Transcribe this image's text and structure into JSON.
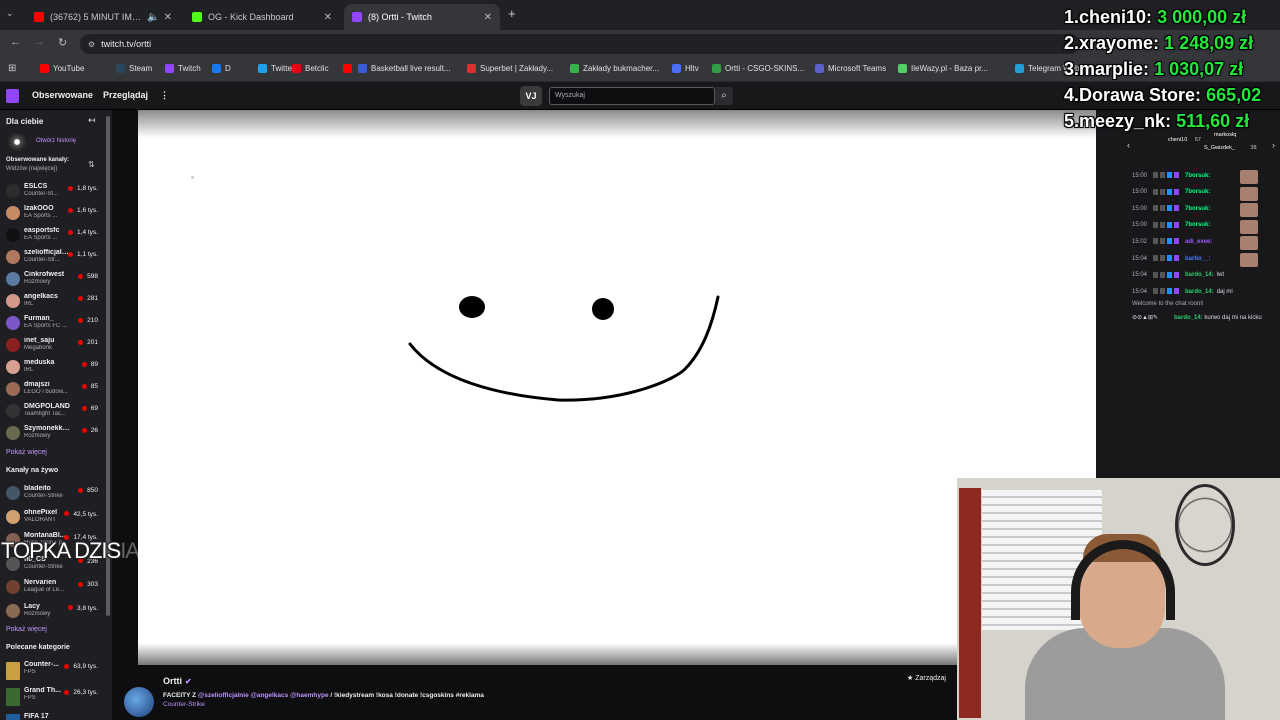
{
  "browser": {
    "tabs": [
      {
        "label": "(36762) 5 MINUT IMPREZY",
        "fav_color": "#ff0000"
      },
      {
        "label": "OG - Kick Dashboard",
        "fav_color": "#53fc18"
      },
      {
        "label": "(8) Ortti - Twitch",
        "fav_color": "#9147ff"
      }
    ],
    "new_tab": "+",
    "url": "twitch.tv/ortti",
    "bookmarks": [
      {
        "label": "YouTube",
        "color": "#ff0000"
      },
      {
        "label": "Steam",
        "color": "#2a475e"
      },
      {
        "label": "Twitch",
        "color": "#9147ff"
      },
      {
        "label": "D",
        "color": "#1877f2"
      },
      {
        "label": "Twitter",
        "color": "#1da1f2"
      },
      {
        "label": "Betclic",
        "color": "#e30613"
      },
      {
        "label": "",
        "color": "#ff0000"
      },
      {
        "label": "Basketball live result...",
        "color": "#3b5bdb"
      },
      {
        "label": "Superbet | Zakłady...",
        "color": "#e03131"
      },
      {
        "label": "Zakłady bukmacher...",
        "color": "#37b24d"
      },
      {
        "label": "Hltv",
        "color": "#4c6ef5"
      },
      {
        "label": "Ortti - CSGO-SKINS...",
        "color": "#2f9e44"
      },
      {
        "label": "Microsoft Teams",
        "color": "#5b5fc7"
      },
      {
        "label": "IleWazy.pl - Baza pr...",
        "color": "#51cf66"
      },
      {
        "label": "Telegram Web",
        "color": "#229ed9"
      }
    ]
  },
  "twitch": {
    "nav_following": "Obserwowane",
    "nav_browse": "Przeglądaj",
    "nav_more": "⋮",
    "prime_badge": "VJ",
    "search_placeholder": "Wyszukaj",
    "search_icon": "magnifier-icon"
  },
  "sidebar": {
    "for_you": "Dla ciebie",
    "collapse": "↤",
    "history_label": "Otwórz historię",
    "followed_heading": "Obserwowane kanały:",
    "followed_sort": "Widzów (najwięcej)",
    "followed": [
      {
        "name": "ESLCS",
        "cat": "Counter-St...",
        "viewers": "1,8 tys.",
        "color": "#2d2d2d"
      },
      {
        "name": "IzakOOO",
        "cat": "EA Sports ...",
        "viewers": "1,6 tys.",
        "color": "#c58b65"
      },
      {
        "name": "easportsfc",
        "cat": "EA Sports ...",
        "viewers": "1,4 tys.",
        "color": "#111111"
      },
      {
        "name": "szeliofficjalnie",
        "cat": "Counter-Str...",
        "viewers": "1,1 tys.",
        "color": "#b07860"
      },
      {
        "name": "Cinkrofwest",
        "cat": "Rozmowy",
        "viewers": "598",
        "color": "#5a7aa0"
      },
      {
        "name": "angelkacs",
        "cat": "IRL",
        "viewers": "281",
        "color": "#d19a88"
      },
      {
        "name": "Furman_",
        "cat": "EA Sports FC ...",
        "viewers": "210",
        "color": "#7a57c8"
      },
      {
        "name": "inet_saju",
        "cat": "Megabonk",
        "viewers": "201",
        "color": "#8a2020"
      },
      {
        "name": "meduska",
        "cat": "IRL",
        "viewers": "89",
        "color": "#d8a090"
      },
      {
        "name": "dmajszi",
        "cat": "LEGO i budow...",
        "viewers": "85",
        "color": "#9a6a55"
      },
      {
        "name": "DMGPOLAND",
        "cat": "Teamfight Tac...",
        "viewers": "69",
        "color": "#333333"
      },
      {
        "name": "Szymonekk17",
        "cat": "Rozmowy",
        "viewers": "26",
        "color": "#6a6a50"
      }
    ],
    "show_more_1": "Pokaż więcej",
    "live_heading": "Kanały na żywo",
    "live": [
      {
        "name": "bladeito",
        "cat": "Counter-Strike",
        "viewers": "850",
        "color": "#445566"
      },
      {
        "name": "ohnePixel",
        "cat": "VALORANT",
        "viewers": "42,5 tys.",
        "color": "#d0a070"
      },
      {
        "name": "MontanaBl...",
        "cat": "Hype Train • pozio...",
        "viewers": "17,4 tys.",
        "color": "#806050"
      },
      {
        "name": "fi0_CS",
        "cat": "Counter-Strike",
        "viewers": "236",
        "color": "#555555"
      },
      {
        "name": "Nervarien",
        "cat": "League of Le...",
        "viewers": "303",
        "color": "#704030"
      },
      {
        "name": "Lacy",
        "cat": "Rozmowy",
        "viewers": "3,8 tys.",
        "color": "#8a6a50"
      }
    ],
    "show_more_2": "Pokaż więcej",
    "cats_heading": "Polecane kategorie",
    "categories": [
      {
        "name": "Counter-...",
        "cat": "FPS",
        "viewers": "63,9 tys.",
        "color": "#c8a040"
      },
      {
        "name": "Grand Th...",
        "cat": "FPS",
        "viewers": "26,3 tys.",
        "color": "#3a6a30"
      },
      {
        "name": "FIFA 17",
        "cat": "",
        "viewers": "",
        "color": "#2060a0"
      }
    ]
  },
  "chat": {
    "top_users": [
      {
        "name": "cheni10",
        "count": "57"
      },
      {
        "name": "markoslq",
        "count": ""
      },
      {
        "name": "S_Gwizdek_",
        "count": "38"
      }
    ],
    "lines": [
      {
        "time": "15:00",
        "user": "7borsuk:",
        "text": "",
        "color": "#00ff7f"
      },
      {
        "time": "15:00",
        "user": "7borsuk:",
        "text": "",
        "color": "#00ff7f"
      },
      {
        "time": "15:00",
        "user": "7borsuk:",
        "text": "",
        "color": "#00ff7f"
      },
      {
        "time": "15:00",
        "user": "7borsuk:",
        "text": "",
        "color": "#00ff7f"
      },
      {
        "time": "15:02",
        "user": "adi_exee:",
        "text": "",
        "color": "#9b59ff"
      },
      {
        "time": "15:04",
        "user": "bartio__:",
        "text": "",
        "color": "#4a78ff"
      },
      {
        "time": "15:04",
        "user": "bardo_14:",
        "text": "lwt",
        "color": "#2ecc71"
      },
      {
        "time": "15:04",
        "user": "bardo_14:",
        "text": "daj mi",
        "color": "#2ecc71"
      }
    ],
    "welcome": "Welcome to the chat room!",
    "last": {
      "user": "bardo_14:",
      "text": "kurwo daj mi na kicku",
      "color": "#2ecc71"
    }
  },
  "stream": {
    "channel": "Ortti",
    "title_prefix": "FACEITY Z ",
    "mentions": "@szeliofficjalnie @angelkacs @haemhype",
    "title_suffix": " / !kiedystream !kosa !donate !csgoskins #reklama",
    "game": "Counter-Strike",
    "manage": "Zarządzaj"
  },
  "overlay": {
    "leaderboard": [
      {
        "rank": "1.",
        "name": "cheni10:",
        "amount": "3 000,00 zł"
      },
      {
        "rank": "2.",
        "name": "xrayome:",
        "amount": "1 248,09 zł"
      },
      {
        "rank": "3.",
        "name": "marplie:",
        "amount": "1 030,07 zł"
      },
      {
        "rank": "4.",
        "name": "Dorawa Store:",
        "amount": "665,02"
      },
      {
        "rank": "5.",
        "name": "meezy_nk:",
        "amount": "511,60 zł"
      }
    ],
    "topka_text": "TOPKA DZIS",
    "topka_fade": "IA:"
  },
  "colors": {
    "twitch_purple": "#9147ff",
    "live_red": "#eb0400",
    "donation_green": "#22e83a"
  }
}
